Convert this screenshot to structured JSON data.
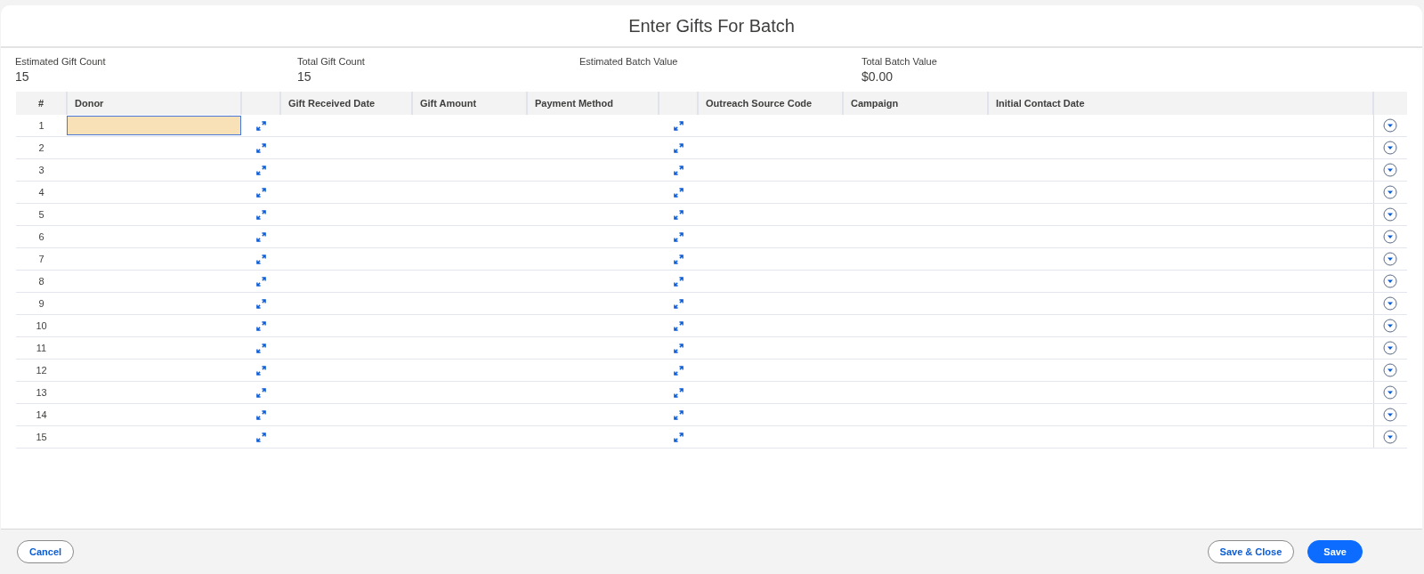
{
  "title": "Enter Gifts For Batch",
  "summary": [
    {
      "label": "Estimated Gift Count",
      "value": "15"
    },
    {
      "label": "Total Gift Count",
      "value": "15"
    },
    {
      "label": "Estimated Batch Value"
    },
    {
      "label": "Total Batch Value",
      "value": "$0.00"
    }
  ],
  "table": {
    "columns": [
      {
        "label": "#",
        "kind": "number"
      },
      {
        "label": "Donor",
        "kind": "text"
      },
      {
        "kind": "expand"
      },
      {
        "label": "Gift Received Date",
        "kind": "text"
      },
      {
        "label": "Gift Amount",
        "kind": "text"
      },
      {
        "label": "Payment Method",
        "kind": "text"
      },
      {
        "kind": "expand"
      },
      {
        "label": "Outreach Source Code",
        "kind": "text"
      },
      {
        "label": "Campaign",
        "kind": "text"
      },
      {
        "label": "Initial Contact Date",
        "kind": "text"
      },
      {
        "kind": "menu"
      }
    ],
    "rows": [
      {
        "number": "1",
        "selected": true
      },
      {
        "number": "2",
        "selected": false
      },
      {
        "number": "3",
        "selected": false
      },
      {
        "number": "4",
        "selected": false
      },
      {
        "number": "5",
        "selected": false
      },
      {
        "number": "6",
        "selected": false
      },
      {
        "number": "7",
        "selected": false
      },
      {
        "number": "8",
        "selected": false
      },
      {
        "number": "9",
        "selected": false
      },
      {
        "number": "10",
        "selected": false
      },
      {
        "number": "11",
        "selected": false
      },
      {
        "number": "12",
        "selected": false
      },
      {
        "number": "13",
        "selected": false
      },
      {
        "number": "14",
        "selected": false
      },
      {
        "number": "15",
        "selected": false
      }
    ]
  },
  "footer": {
    "cancel": "Cancel",
    "save_close": "Save & Close",
    "save": "Save"
  }
}
